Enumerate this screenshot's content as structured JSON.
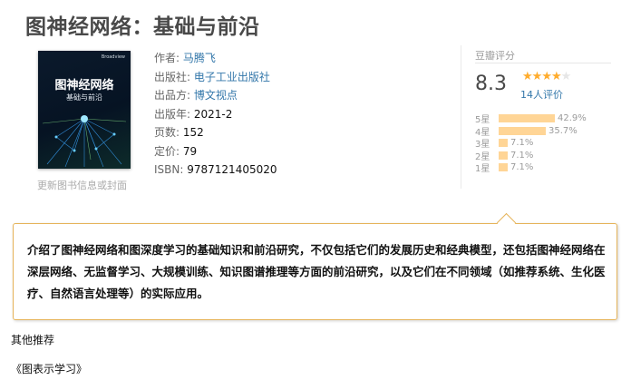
{
  "page_title": "图神经网络：基础与前沿",
  "cover": {
    "publisher_mark": "Broadview",
    "title": "图神经网络",
    "subtitle": "基础与前沿"
  },
  "update_link": "更新图书信息或封面",
  "info": {
    "author_label": "作者:",
    "author": "马腾飞",
    "publisher_label": "出版社:",
    "publisher": "电子工业出版社",
    "producer_label": "出品方:",
    "producer": "博文视点",
    "year_label": "出版年:",
    "year": "2021-2",
    "pages_label": "页数:",
    "pages": "152",
    "price_label": "定价:",
    "price": "79",
    "isbn_label": "ISBN:",
    "isbn": "9787121405020"
  },
  "rating": {
    "label": "豆瓣评分",
    "score": "8.3",
    "stars_filled": 4,
    "stars_total": 5,
    "count": "14人评价",
    "distribution": [
      {
        "label": "5星",
        "percent": 42.9,
        "text": "42.9%"
      },
      {
        "label": "4星",
        "percent": 35.7,
        "text": "35.7%"
      },
      {
        "label": "3星",
        "percent": 7.1,
        "text": "7.1%"
      },
      {
        "label": "2星",
        "percent": 7.1,
        "text": "7.1%"
      },
      {
        "label": "1星",
        "percent": 7.1,
        "text": "7.1%"
      }
    ]
  },
  "description": "介绍了图神经网络和图深度学习的基础知识和前沿研究，不仅包括它们的发展历史和经典模型，还包括图神经网络在深层网络、无监督学习、大规模训练、知识图谱推理等方面的前沿研究，以及它们在不同领域（如推荐系统、生化医疗、自然语言处理等）的实际应用。",
  "other_section": "其他推荐",
  "recommendation": "《图表示学习》",
  "colors": {
    "star": "#ffac2d",
    "bar": "#ffd596",
    "link": "#3377aa",
    "box_border": "#e6b45a"
  }
}
